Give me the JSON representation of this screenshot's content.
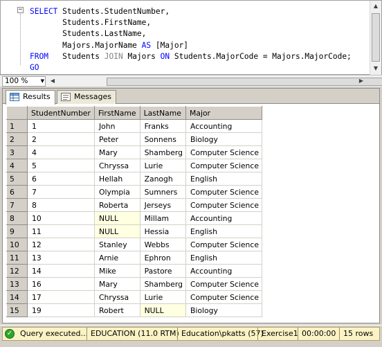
{
  "editor": {
    "lines": [
      {
        "parts": [
          {
            "t": "SELECT",
            "c": "kw"
          },
          {
            "t": " Students.StudentNumber,",
            "c": ""
          }
        ]
      },
      {
        "parts": [
          {
            "t": "       Students.FirstName,",
            "c": ""
          }
        ]
      },
      {
        "parts": [
          {
            "t": "       Students.LastName,",
            "c": ""
          }
        ]
      },
      {
        "parts": [
          {
            "t": "       Majors.MajorName ",
            "c": ""
          },
          {
            "t": "AS",
            "c": "kw"
          },
          {
            "t": " [Major]",
            "c": ""
          }
        ]
      },
      {
        "parts": [
          {
            "t": "FROM",
            "c": "kw"
          },
          {
            "t": "   Students ",
            "c": ""
          },
          {
            "t": "JOIN",
            "c": "gray"
          },
          {
            "t": " Majors ",
            "c": ""
          },
          {
            "t": "ON",
            "c": "kw"
          },
          {
            "t": " Students.MajorCode = Majors.MajorCode;",
            "c": ""
          }
        ]
      },
      {
        "parts": [
          {
            "t": "GO",
            "c": "kw"
          }
        ]
      }
    ],
    "collapse_glyph": "−"
  },
  "zoom": {
    "value": "100 %"
  },
  "tabs": {
    "results": "Results",
    "messages": "Messages"
  },
  "grid": {
    "columns": [
      "StudentNumber",
      "FirstName",
      "LastName",
      "Major"
    ],
    "rows": [
      [
        "1",
        "1",
        "John",
        "Franks",
        "Accounting"
      ],
      [
        "2",
        "2",
        "Peter",
        "Sonnens",
        "Biology"
      ],
      [
        "3",
        "4",
        "Mary",
        "Shamberg",
        "Computer Science"
      ],
      [
        "4",
        "5",
        "Chryssa",
        "Lurie",
        "Computer Science"
      ],
      [
        "5",
        "6",
        "Hellah",
        "Zanogh",
        "English"
      ],
      [
        "6",
        "7",
        "Olympia",
        "Sumners",
        "Computer Science"
      ],
      [
        "7",
        "8",
        "Roberta",
        "Jerseys",
        "Computer Science"
      ],
      [
        "8",
        "10",
        "NULL",
        "Millam",
        "Accounting"
      ],
      [
        "9",
        "11",
        "NULL",
        "Hessia",
        "English"
      ],
      [
        "10",
        "12",
        "Stanley",
        "Webbs",
        "Computer Science"
      ],
      [
        "11",
        "13",
        "Arnie",
        "Ephron",
        "English"
      ],
      [
        "12",
        "14",
        "Mike",
        "Pastore",
        "Accounting"
      ],
      [
        "13",
        "16",
        "Mary",
        "Shamberg",
        "Computer Science"
      ],
      [
        "14",
        "17",
        "Chryssa",
        "Lurie",
        "Computer Science"
      ],
      [
        "15",
        "19",
        "Robert",
        "NULL",
        "Biology"
      ]
    ]
  },
  "status": {
    "message": "Query executed...",
    "server": "EDUCATION (11.0 RTM)",
    "user": "Education\\pkatts (57)",
    "database": "Exercise1",
    "elapsed": "00:00:00",
    "rows": "15 rows"
  },
  "colors": {
    "keyword": "#0000ff",
    "status_bg": "#fbf3c5",
    "null_bg": "#ffffe1"
  }
}
